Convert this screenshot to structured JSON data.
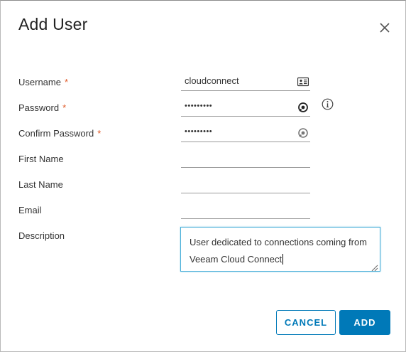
{
  "dialog": {
    "title": "Add User",
    "close_icon": "close-icon"
  },
  "form": {
    "username": {
      "label": "Username",
      "required_mark": "*",
      "value": "cloudconnect",
      "icon": "contact-card-icon"
    },
    "password": {
      "label": "Password",
      "required_mark": "*",
      "value": "•••••••••",
      "icon": "password-reveal-icon",
      "info_icon": "info-icon"
    },
    "confirm_password": {
      "label": "Confirm Password",
      "required_mark": "*",
      "value": "•••••••••",
      "icon": "password-reveal-icon"
    },
    "first_name": {
      "label": "First Name",
      "value": ""
    },
    "last_name": {
      "label": "Last Name",
      "value": ""
    },
    "email": {
      "label": "Email",
      "value": ""
    },
    "description": {
      "label": "Description",
      "value": "User dedicated to connections coming from Veeam Cloud Connect"
    }
  },
  "footer": {
    "cancel_label": "CANCEL",
    "add_label": "ADD"
  },
  "colors": {
    "primary": "#0079b8",
    "required": "#e05a28",
    "focus_border": "#49afd9"
  }
}
